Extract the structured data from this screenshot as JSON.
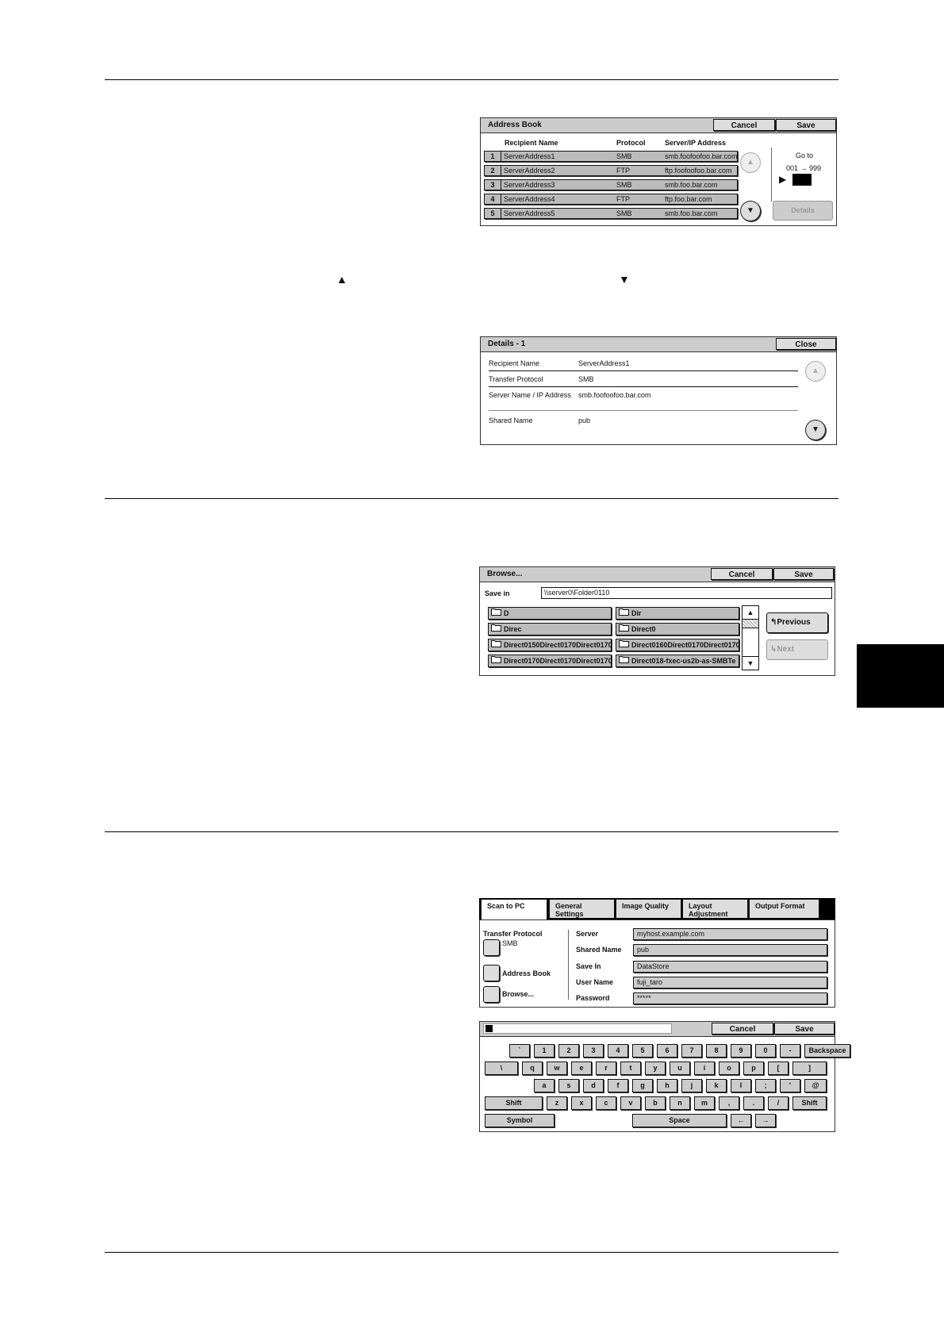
{
  "address_book": {
    "title": "Address Book",
    "cancel": "Cancel",
    "save": "Save",
    "headers": {
      "name": "Recipient Name",
      "protocol": "Protocol",
      "server": "Server/IP Address"
    },
    "rows": [
      {
        "num": "1",
        "name": "ServerAddress1",
        "protocol": "SMB",
        "server": "smb.foofoofoo.bar.com"
      },
      {
        "num": "2",
        "name": "ServerAddress2",
        "protocol": "FTP",
        "server": "ftp.foofoofoo.bar.com"
      },
      {
        "num": "3",
        "name": "ServerAddress3",
        "protocol": "SMB",
        "server": "smb.foo.bar.com"
      },
      {
        "num": "4",
        "name": "ServerAddress4",
        "protocol": "FTP",
        "server": "ftp.foo.bar.com"
      },
      {
        "num": "5",
        "name": "ServerAddress5",
        "protocol": "SMB",
        "server": "smb.foo.bar.com"
      }
    ],
    "goto_label": "Go to",
    "goto_range": "001 → 999",
    "details": "Details"
  },
  "glyphs": {
    "up": "▲",
    "down": "▼"
  },
  "details_panel": {
    "title": "Details - 1",
    "close": "Close",
    "fields": [
      {
        "label": "Recipient Name",
        "value": "ServerAddress1"
      },
      {
        "label": "Transfer Protocol",
        "value": "SMB"
      },
      {
        "label": "Server Name / IP Address",
        "value": "smb.foofoofoo.bar.com"
      },
      {
        "label": "Shared Name",
        "value": "pub"
      }
    ]
  },
  "browse": {
    "title": "Browse...",
    "cancel": "Cancel",
    "save": "Save",
    "save_in_label": "Save in",
    "save_in_value": "\\\\server0\\Folder0110",
    "folders_left": [
      "D",
      "Direc",
      "Direct0150Direct0170Direct0170",
      "Direct0170Direct0170Direct0170"
    ],
    "folders_right": [
      "Dir",
      "Direct0",
      "Direct0160Direct0170Direct0170",
      "Direct018-fxec-us2b-as-SMBTe"
    ],
    "previous": "Previous",
    "next": "Next"
  },
  "scan_to_pc": {
    "tabs": [
      "Scan to PC",
      "General Settings",
      "Image Quality",
      "Layout Adjustment",
      "Output Format"
    ],
    "transfer_protocol_label": "Transfer Protocol",
    "transfer_protocol_value": "SMB",
    "address_book": "Address Book",
    "browse": "Browse...",
    "field_labels": [
      "Server",
      "Shared Name",
      "Save In",
      "User Name",
      "Password"
    ],
    "field_values": [
      "myhost.example.com",
      "pub",
      "DataStore",
      "fuji_taro",
      "*****"
    ]
  },
  "keyboard": {
    "cancel": "Cancel",
    "save": "Save",
    "row1": [
      "`",
      "1",
      "2",
      "3",
      "4",
      "5",
      "6",
      "7",
      "8",
      "9",
      "0",
      "-"
    ],
    "backspace": "Backspace",
    "row2": [
      "\\",
      "q",
      "w",
      "e",
      "r",
      "t",
      "y",
      "u",
      "i",
      "o",
      "p",
      "[",
      "]"
    ],
    "row3": [
      "a",
      "s",
      "d",
      "f",
      "g",
      "h",
      "j",
      "k",
      "l",
      ";",
      "'",
      "@"
    ],
    "shift": "Shift",
    "row4": [
      "z",
      "x",
      "c",
      "v",
      "b",
      "n",
      "m",
      ",",
      ".",
      "/"
    ],
    "symbol": "Symbol",
    "space": "Space",
    "left": "←",
    "right": "→"
  }
}
